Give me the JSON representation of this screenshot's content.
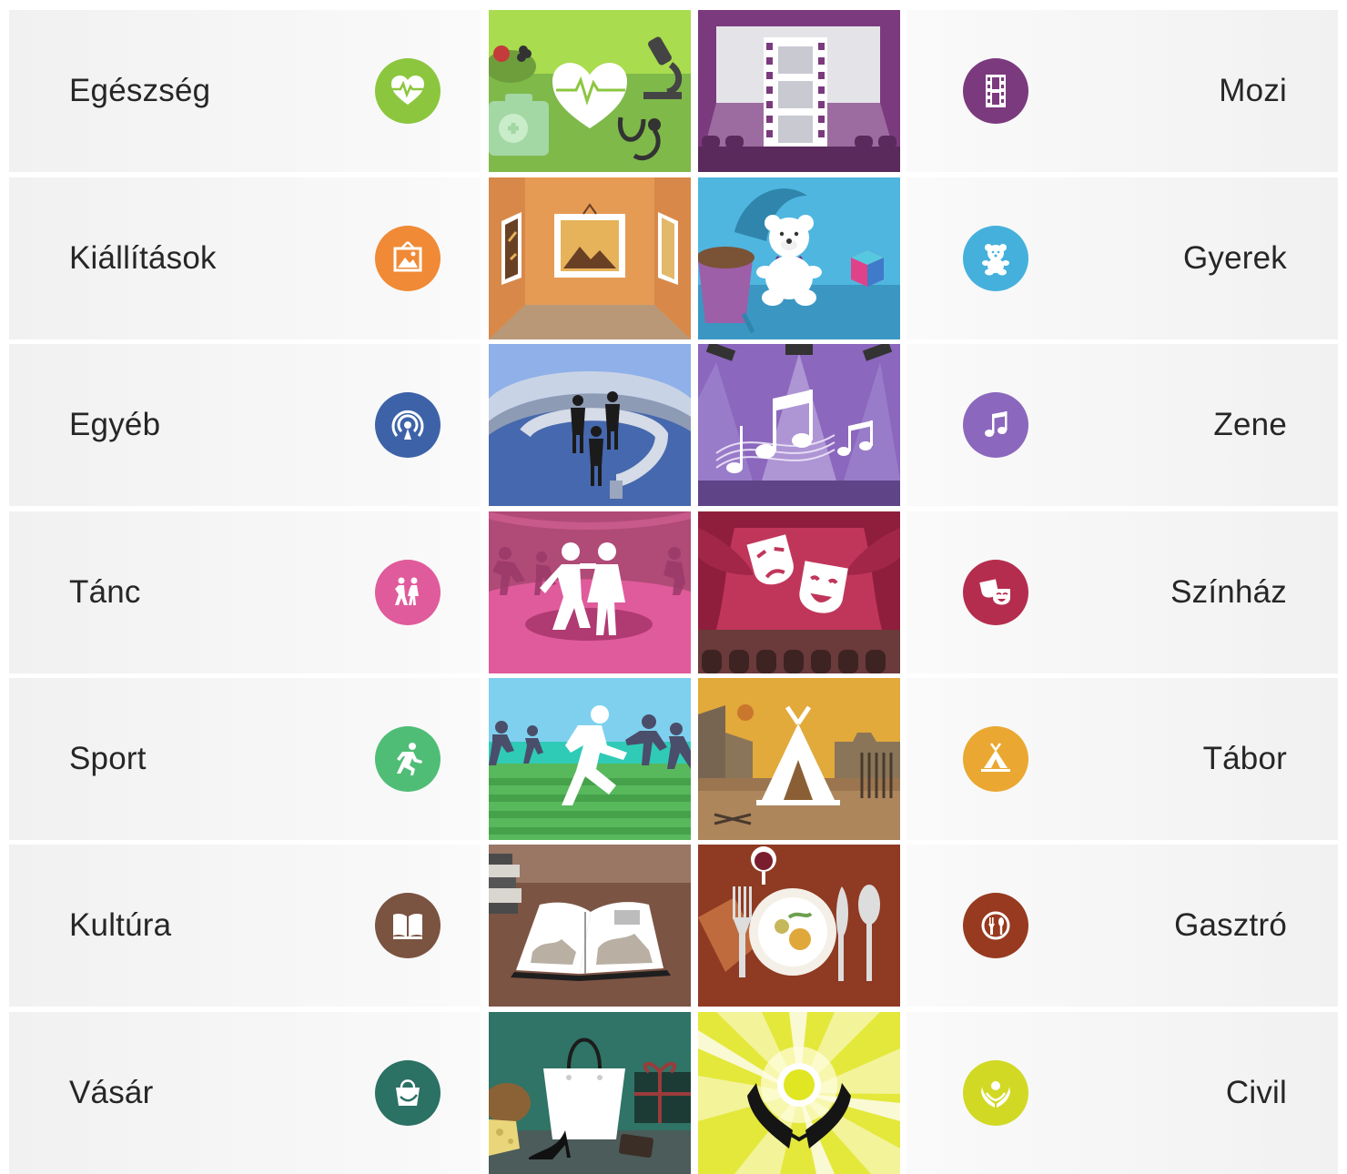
{
  "categories": {
    "egeszseg": {
      "label": "Egészség",
      "color": "#8cc63f",
      "icon": "heart-pulse-icon"
    },
    "mozi": {
      "label": "Mozi",
      "color": "#7b3a7e",
      "icon": "film-strip-icon"
    },
    "kiallitasok": {
      "label": "Kiállítások",
      "color": "#f08a36",
      "icon": "picture-frame-icon"
    },
    "gyerek": {
      "label": "Gyerek",
      "color": "#45b0dc",
      "icon": "teddy-bear-icon"
    },
    "egyeb": {
      "label": "Egyéb",
      "color": "#3d62a8",
      "icon": "broadcast-icon"
    },
    "zene": {
      "label": "Zene",
      "color": "#8b67bd",
      "icon": "music-note-icon"
    },
    "tanc": {
      "label": "Tánc",
      "color": "#e05b9b",
      "icon": "dancers-icon"
    },
    "szinhaz": {
      "label": "Színház",
      "color": "#b52d4e",
      "icon": "theater-masks-icon"
    },
    "sport": {
      "label": "Sport",
      "color": "#4fbd76",
      "icon": "runner-icon"
    },
    "tabor": {
      "label": "Tábor",
      "color": "#eaa832",
      "icon": "tent-icon"
    },
    "kultura": {
      "label": "Kultúra",
      "color": "#7a5341",
      "icon": "open-book-icon"
    },
    "gasztro": {
      "label": "Gasztró",
      "color": "#973a1f",
      "icon": "fork-knife-icon"
    },
    "vasar": {
      "label": "Vásár",
      "color": "#2b7164",
      "icon": "shopping-bag-icon"
    },
    "civil": {
      "label": "Civil",
      "color": "#d1d925",
      "icon": "caring-hands-icon"
    }
  }
}
